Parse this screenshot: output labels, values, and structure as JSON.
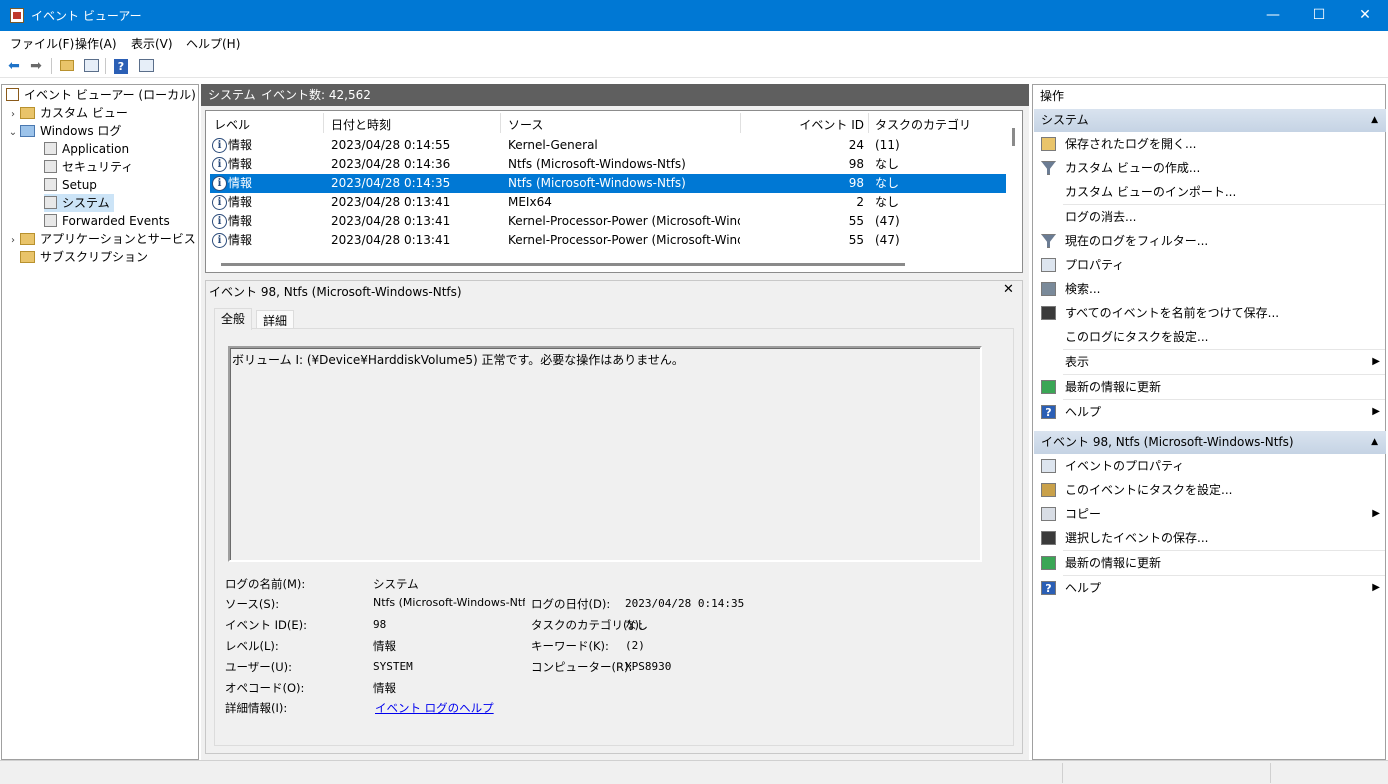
{
  "window": {
    "title": "イベント ビューアー"
  },
  "window_controls": {
    "minimize": "—",
    "maximize": "☐",
    "close": "✕"
  },
  "menu": [
    "ファイル(F)",
    "操作(A)",
    "表示(V)",
    "ヘルプ(H)"
  ],
  "tree": {
    "root": "イベント ビューアー (ローカル)",
    "custom_views": "カスタム ビュー",
    "windows_logs": "Windows ログ",
    "logs": [
      "Application",
      "セキュリティ",
      "Setup",
      "システム",
      "Forwarded Events"
    ],
    "app_service_logs": "アプリケーションとサービス ログ",
    "subscriptions": "サブスクリプション"
  },
  "center": {
    "header_title": "システム",
    "header_count": "イベント数: 42,562",
    "columns": [
      "レベル",
      "日付と時刻",
      "ソース",
      "イベント ID",
      "タスクのカテゴリ"
    ],
    "rows": [
      {
        "level": "情報",
        "datetime": "2023/04/28 0:14:55",
        "source": "Kernel-General",
        "id": "24",
        "category": "(11)"
      },
      {
        "level": "情報",
        "datetime": "2023/04/28 0:14:36",
        "source": "Ntfs (Microsoft-Windows-Ntfs)",
        "id": "98",
        "category": "なし"
      },
      {
        "level": "情報",
        "datetime": "2023/04/28 0:14:35",
        "source": "Ntfs (Microsoft-Windows-Ntfs)",
        "id": "98",
        "category": "なし"
      },
      {
        "level": "情報",
        "datetime": "2023/04/28 0:13:41",
        "source": "MEIx64",
        "id": "2",
        "category": "なし"
      },
      {
        "level": "情報",
        "datetime": "2023/04/28 0:13:41",
        "source": "Kernel-Processor-Power (Microsoft-Wind...",
        "id": "55",
        "category": "(47)"
      },
      {
        "level": "情報",
        "datetime": "2023/04/28 0:13:41",
        "source": "Kernel-Processor-Power (Microsoft-Wind...",
        "id": "55",
        "category": "(47)"
      }
    ],
    "selected_row_index": 2
  },
  "detail": {
    "title": "イベント 98, Ntfs (Microsoft-Windows-Ntfs)",
    "close": "✕",
    "tabs": [
      "全般",
      "詳細"
    ],
    "message": "ボリューム I: (¥Device¥HarddiskVolume5) 正常です。必要な操作はありません。",
    "fields": {
      "log_name_label": "ログの名前(M):",
      "log_name": "システム",
      "source_label": "ソース(S):",
      "source": "Ntfs (Microsoft-Windows-Ntf",
      "logged_label": "ログの日付(D):",
      "logged": "2023/04/28 0:14:35",
      "event_id_label": "イベント ID(E):",
      "event_id": "98",
      "task_label": "タスクのカテゴリ(Y):",
      "task": "なし",
      "level_label": "レベル(L):",
      "level": "情報",
      "keywords_label": "キーワード(K):",
      "keywords": "(2)",
      "user_label": "ユーザー(U):",
      "user": "SYSTEM",
      "computer_label": "コンピューター(R):",
      "computer": "XPS8930",
      "opcode_label": "オペコード(O):",
      "opcode": "情報",
      "more_info_label": "詳細情報(I):",
      "more_info": "イベント ログのヘルプ"
    }
  },
  "actions": {
    "header": "操作",
    "section1": "システム",
    "items1": [
      "保存されたログを開く...",
      "カスタム ビューの作成...",
      "カスタム ビューのインポート...",
      "ログの消去...",
      "現在のログをフィルター...",
      "プロパティ",
      "検索...",
      "すべてのイベントを名前をつけて保存...",
      "このログにタスクを設定...",
      "表示",
      "最新の情報に更新",
      "ヘルプ"
    ],
    "section2": "イベント 98, Ntfs (Microsoft-Windows-Ntfs)",
    "items2": [
      "イベントのプロパティ",
      "このイベントにタスクを設定...",
      "コピー",
      "選択したイベントの保存...",
      "最新の情報に更新",
      "ヘルプ"
    ]
  },
  "colors": {
    "titlebar": "#0078d4",
    "selection": "#0078d4",
    "tree_selection": "#cce4f7",
    "section_bg": "#d3deeb",
    "pane_header": "#5f5f5f"
  }
}
